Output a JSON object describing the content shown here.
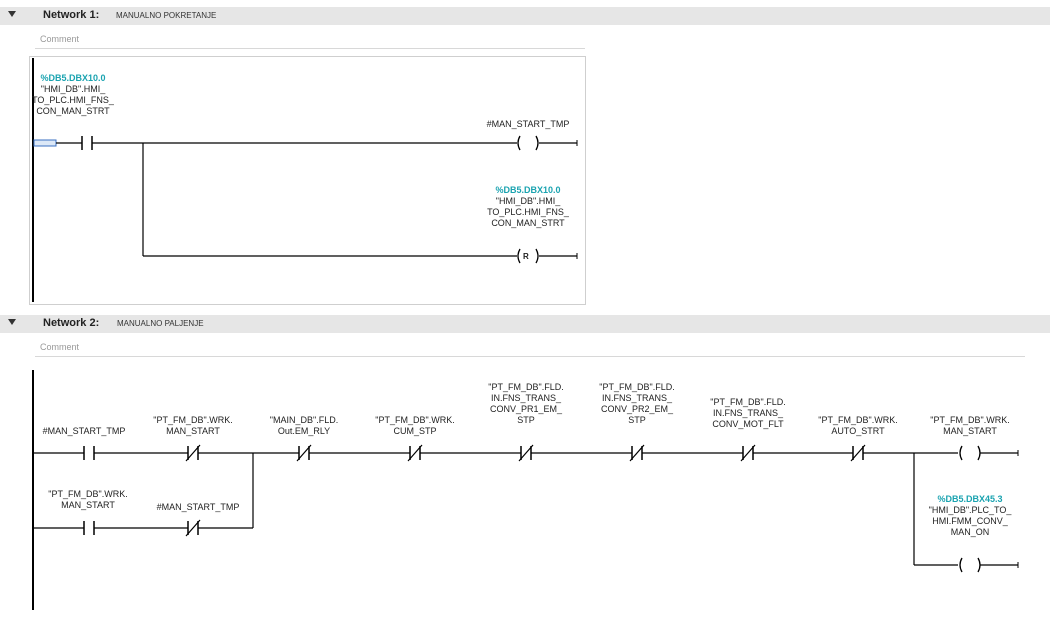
{
  "network1": {
    "title": "Network 1:",
    "name": "MANUALNO POKRETANJE",
    "comment": "Comment",
    "contact": {
      "address": "%DB5.DBX10.0",
      "tag": [
        "\"HMI_DB\".HMI_",
        "TO_PLC.HMI_FNS_",
        "CON_MAN_STRT"
      ]
    },
    "coil_set": {
      "tag": "#MAN_START_TMP"
    },
    "coil_reset": {
      "address": "%DB5.DBX10.0",
      "tag": [
        "\"HMI_DB\".HMI_",
        "TO_PLC.HMI_FNS_",
        "CON_MAN_STRT"
      ],
      "symbol": "R"
    }
  },
  "network2": {
    "title": "Network 2:",
    "name": "MANUALNO PALJENJE",
    "comment": "Comment",
    "contacts": [
      {
        "tag": [
          "#MAN_START_TMP"
        ],
        "type": "NO"
      },
      {
        "tag": [
          "\"PT_FM_DB\".WRK.",
          "MAN_START"
        ],
        "type": "NC"
      },
      {
        "tag": [
          "\"MAIN_DB\".FLD.",
          "Out.EM_RLY"
        ],
        "type": "NC"
      },
      {
        "tag": [
          "\"PT_FM_DB\".WRK.",
          "CUM_STP"
        ],
        "type": "NC"
      },
      {
        "tag": [
          "\"PT_FM_DB\".FLD.",
          "IN.FNS_TRANS_",
          "CONV_PR1_EM_",
          "STP"
        ],
        "type": "NC"
      },
      {
        "tag": [
          "\"PT_FM_DB\".FLD.",
          "IN.FNS_TRANS_",
          "CONV_PR2_EM_",
          "STP"
        ],
        "type": "NC"
      },
      {
        "tag": [
          "\"PT_FM_DB\".FLD.",
          "IN.FNS_TRANS_",
          "CONV_MOT_FLT"
        ],
        "type": "NC"
      },
      {
        "tag": [
          "\"PT_FM_DB\".WRK.",
          "AUTO_STRT"
        ],
        "type": "NC"
      }
    ],
    "branch_contacts": [
      {
        "tag": [
          "\"PT_FM_DB\".WRK.",
          "MAN_START"
        ],
        "type": "NO"
      },
      {
        "tag": [
          "#MAN_START_TMP"
        ],
        "type": "NC"
      }
    ],
    "coil1": {
      "tag": [
        "\"PT_FM_DB\".WRK.",
        "MAN_START"
      ]
    },
    "coil2": {
      "address": "%DB5.DBX45.3",
      "tag": [
        "\"HMI_DB\".PLC_TO_",
        "HMI.FMM_CONV_",
        "MAN_ON"
      ]
    }
  }
}
